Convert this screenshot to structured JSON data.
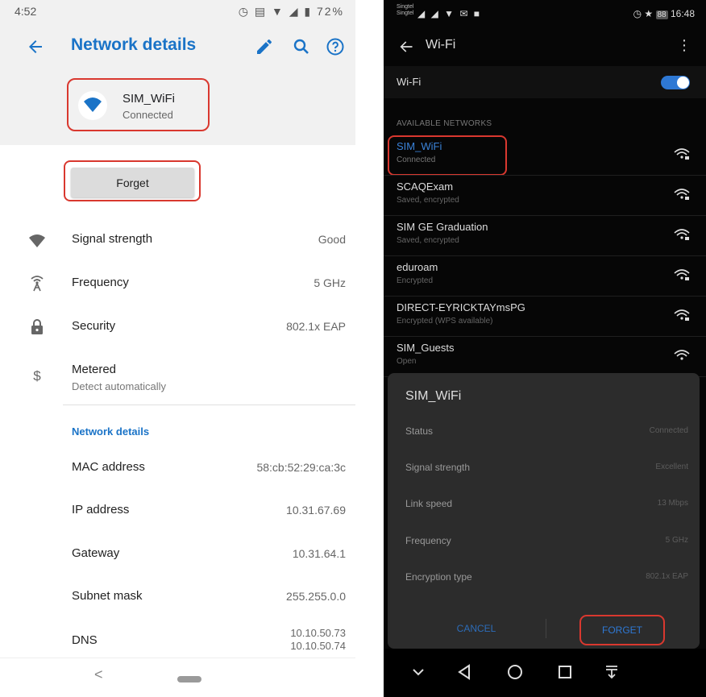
{
  "left": {
    "status_bar": {
      "time": "4:52",
      "battery": "72%"
    },
    "header": {
      "title": "Network details"
    },
    "network": {
      "ssid": "SIM_WiFi",
      "status": "Connected"
    },
    "forget_label": "Forget",
    "rows": [
      {
        "label": "Signal strength",
        "value": "Good",
        "icon": "wifi-signal-icon"
      },
      {
        "label": "Frequency",
        "value": "5 GHz",
        "icon": "antenna-icon"
      },
      {
        "label": "Security",
        "value": "802.1x EAP",
        "icon": "lock-icon"
      }
    ],
    "metered": {
      "label": "Metered",
      "sub": "Detect automatically",
      "icon": "dollar-icon"
    },
    "section_title": "Network details",
    "details": [
      {
        "label": "MAC address",
        "value": "58:cb:52:29:ca:3c"
      },
      {
        "label": "IP address",
        "value": "10.31.67.69"
      },
      {
        "label": "Gateway",
        "value": "10.31.64.1"
      },
      {
        "label": "Subnet mask",
        "value": "255.255.0.0"
      }
    ],
    "dns": {
      "label": "DNS",
      "value1": "10.10.50.73",
      "value2": "10.10.50.74"
    },
    "nav": {
      "back": "<"
    }
  },
  "right": {
    "status_bar": {
      "carrier1": "Singtel",
      "carrier2": "Singtel",
      "battery": "88",
      "time": "16:48"
    },
    "app_bar": {
      "title": "Wi-Fi"
    },
    "wifi_toggle": {
      "label": "Wi-Fi",
      "on": true
    },
    "section_title": "AVAILABLE NETWORKS",
    "networks": [
      {
        "name": "SIM_WiFi",
        "status": "Connected"
      },
      {
        "name": "SCAQExam",
        "status": "Saved, encrypted"
      },
      {
        "name": "SIM GE Graduation",
        "status": "Saved, encrypted"
      },
      {
        "name": "eduroam",
        "status": "Encrypted"
      },
      {
        "name": "DIRECT-EYRICKTAYmsPG",
        "status": "Encrypted (WPS available)"
      },
      {
        "name": "SIM_Guests",
        "status": "Open"
      }
    ],
    "dialog": {
      "title": "SIM_WiFi",
      "rows": [
        {
          "label": "Status",
          "value": "Connected"
        },
        {
          "label": "Signal strength",
          "value": "Excellent"
        },
        {
          "label": "Link speed",
          "value": "13 Mbps"
        },
        {
          "label": "Frequency",
          "value": "5 GHz"
        },
        {
          "label": "Encryption type",
          "value": "802.1x EAP"
        }
      ],
      "cancel_label": "CANCEL",
      "forget_label": "FORGET"
    }
  },
  "colors": {
    "accent_blue": "#1a73c7",
    "highlight_red": "#d9382f",
    "dark_bg": "#060606",
    "dialog_bg": "#2c2c2c"
  }
}
